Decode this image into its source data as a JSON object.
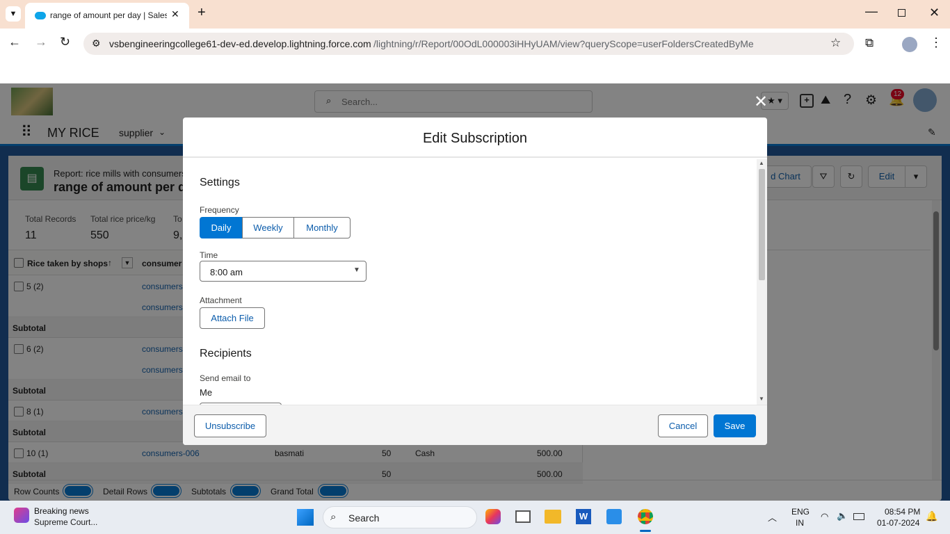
{
  "browser": {
    "tab_title": "range of amount per day | Sales",
    "url_host": "vsbengineeringcollege61-dev-ed.develop.lightning.force.com",
    "url_path": "/lightning/r/Report/00OdL000003iHHyUAM/view?queryScope=userFoldersCreatedByMe"
  },
  "sf": {
    "search_placeholder": "Search...",
    "app_name": "MY RICE",
    "nav_item": "supplier",
    "notif_count": "12",
    "report_type": "Report: rice mills with consumers",
    "report_title": "range of amount per day",
    "add_chart": "d Chart",
    "edit": "Edit",
    "summary": [
      {
        "label": "Total Records",
        "value": "11"
      },
      {
        "label": "Total rice price/kg",
        "value": "550"
      },
      {
        "label": "To",
        "value": "9,0"
      }
    ],
    "col1_header": "Rice taken by shops",
    "col2_header": "consumer",
    "rows": [
      {
        "group": "5 (2)",
        "links": [
          "consumers",
          "consumers"
        ]
      },
      {
        "group": "6 (2)",
        "links": [
          "consumers",
          "consumers"
        ]
      },
      {
        "group": "8 (1)",
        "links": [
          "consumers"
        ]
      }
    ],
    "subtotal": "Subtotal",
    "row10": {
      "group": "10 (1)",
      "link": "consumers-006",
      "type": "basmati",
      "qty": "50",
      "pay": "Cash",
      "amt": "500.00"
    },
    "row10_sub": {
      "qty": "50",
      "amt": "500.00"
    },
    "toggles": [
      "Row Counts",
      "Detail Rows",
      "Subtotals",
      "Grand Total"
    ]
  },
  "modal": {
    "title": "Edit Subscription",
    "settings": "Settings",
    "frequency_label": "Frequency",
    "freq_options": [
      "Daily",
      "Weekly",
      "Monthly"
    ],
    "time_label": "Time",
    "time_value": "8:00 am",
    "attachment_label": "Attachment",
    "attach_button": "Attach File",
    "recipients": "Recipients",
    "send_label": "Send email to",
    "send_value": "Me",
    "unsubscribe": "Unsubscribe",
    "cancel": "Cancel",
    "save": "Save"
  },
  "taskbar": {
    "news_title": "Breaking news",
    "news_sub": "Supreme Court...",
    "search": "Search",
    "lang1": "ENG",
    "lang2": "IN",
    "time": "08:54 PM",
    "date": "01-07-2024"
  }
}
